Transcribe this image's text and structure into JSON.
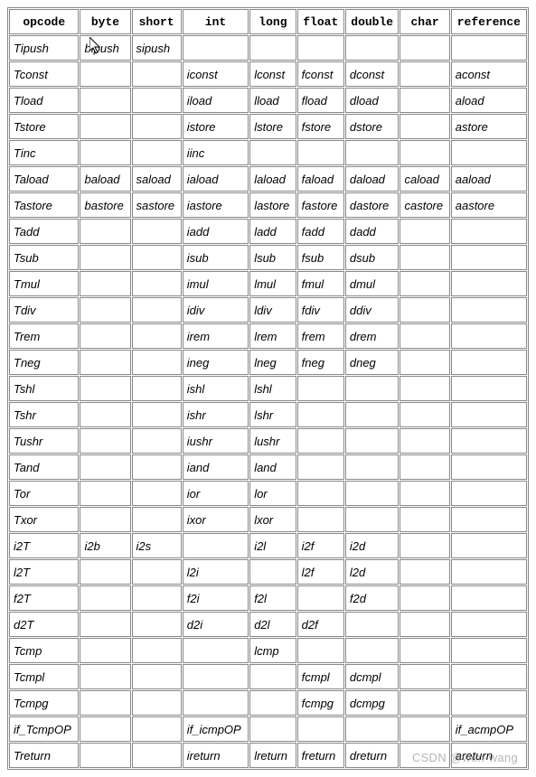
{
  "watermark": "CSDN @wen-wang",
  "table": {
    "headers": [
      "opcode",
      "byte",
      "short",
      "int",
      "long",
      "float",
      "double",
      "char",
      "reference"
    ],
    "rows": [
      {
        "opcode": "Tipush",
        "byte": "bipush",
        "short": "sipush",
        "int": "",
        "long": "",
        "float": "",
        "double": "",
        "char": "",
        "reference": ""
      },
      {
        "opcode": "Tconst",
        "byte": "",
        "short": "",
        "int": "iconst",
        "long": "lconst",
        "float": "fconst",
        "double": "dconst",
        "char": "",
        "reference": "aconst"
      },
      {
        "opcode": "Tload",
        "byte": "",
        "short": "",
        "int": "iload",
        "long": "lload",
        "float": "fload",
        "double": "dload",
        "char": "",
        "reference": "aload"
      },
      {
        "opcode": "Tstore",
        "byte": "",
        "short": "",
        "int": "istore",
        "long": "lstore",
        "float": "fstore",
        "double": "dstore",
        "char": "",
        "reference": "astore"
      },
      {
        "opcode": "Tinc",
        "byte": "",
        "short": "",
        "int": "iinc",
        "long": "",
        "float": "",
        "double": "",
        "char": "",
        "reference": ""
      },
      {
        "opcode": "Taload",
        "byte": "baload",
        "short": "saload",
        "int": "iaload",
        "long": "laload",
        "float": "faload",
        "double": "daload",
        "char": "caload",
        "reference": "aaload"
      },
      {
        "opcode": "Tastore",
        "byte": "bastore",
        "short": "sastore",
        "int": "iastore",
        "long": "lastore",
        "float": "fastore",
        "double": "dastore",
        "char": "castore",
        "reference": "aastore"
      },
      {
        "opcode": "Tadd",
        "byte": "",
        "short": "",
        "int": "iadd",
        "long": "ladd",
        "float": "fadd",
        "double": "dadd",
        "char": "",
        "reference": ""
      },
      {
        "opcode": "Tsub",
        "byte": "",
        "short": "",
        "int": "isub",
        "long": "lsub",
        "float": "fsub",
        "double": "dsub",
        "char": "",
        "reference": ""
      },
      {
        "opcode": "Tmul",
        "byte": "",
        "short": "",
        "int": "imul",
        "long": "lmul",
        "float": "fmul",
        "double": "dmul",
        "char": "",
        "reference": ""
      },
      {
        "opcode": "Tdiv",
        "byte": "",
        "short": "",
        "int": "idiv",
        "long": "ldiv",
        "float": "fdiv",
        "double": "ddiv",
        "char": "",
        "reference": ""
      },
      {
        "opcode": "Trem",
        "byte": "",
        "short": "",
        "int": "irem",
        "long": "lrem",
        "float": "frem",
        "double": "drem",
        "char": "",
        "reference": ""
      },
      {
        "opcode": "Tneg",
        "byte": "",
        "short": "",
        "int": "ineg",
        "long": "lneg",
        "float": "fneg",
        "double": "dneg",
        "char": "",
        "reference": ""
      },
      {
        "opcode": "Tshl",
        "byte": "",
        "short": "",
        "int": "ishl",
        "long": "lshl",
        "float": "",
        "double": "",
        "char": "",
        "reference": ""
      },
      {
        "opcode": "Tshr",
        "byte": "",
        "short": "",
        "int": "ishr",
        "long": "lshr",
        "float": "",
        "double": "",
        "char": "",
        "reference": ""
      },
      {
        "opcode": "Tushr",
        "byte": "",
        "short": "",
        "int": "iushr",
        "long": "lushr",
        "float": "",
        "double": "",
        "char": "",
        "reference": ""
      },
      {
        "opcode": "Tand",
        "byte": "",
        "short": "",
        "int": "iand",
        "long": "land",
        "float": "",
        "double": "",
        "char": "",
        "reference": ""
      },
      {
        "opcode": "Tor",
        "byte": "",
        "short": "",
        "int": "ior",
        "long": "lor",
        "float": "",
        "double": "",
        "char": "",
        "reference": ""
      },
      {
        "opcode": "Txor",
        "byte": "",
        "short": "",
        "int": "ixor",
        "long": "lxor",
        "float": "",
        "double": "",
        "char": "",
        "reference": ""
      },
      {
        "opcode": "i2T",
        "byte": "i2b",
        "short": "i2s",
        "int": "",
        "long": "i2l",
        "float": "i2f",
        "double": "i2d",
        "char": "",
        "reference": ""
      },
      {
        "opcode": "l2T",
        "byte": "",
        "short": "",
        "int": "l2i",
        "long": "",
        "float": "l2f",
        "double": "l2d",
        "char": "",
        "reference": ""
      },
      {
        "opcode": "f2T",
        "byte": "",
        "short": "",
        "int": "f2i",
        "long": "f2l",
        "float": "",
        "double": "f2d",
        "char": "",
        "reference": ""
      },
      {
        "opcode": "d2T",
        "byte": "",
        "short": "",
        "int": "d2i",
        "long": "d2l",
        "float": "d2f",
        "double": "",
        "char": "",
        "reference": ""
      },
      {
        "opcode": "Tcmp",
        "byte": "",
        "short": "",
        "int": "",
        "long": "lcmp",
        "float": "",
        "double": "",
        "char": "",
        "reference": ""
      },
      {
        "opcode": "Tcmpl",
        "byte": "",
        "short": "",
        "int": "",
        "long": "",
        "float": "fcmpl",
        "double": "dcmpl",
        "char": "",
        "reference": ""
      },
      {
        "opcode": "Tcmpg",
        "byte": "",
        "short": "",
        "int": "",
        "long": "",
        "float": "fcmpg",
        "double": "dcmpg",
        "char": "",
        "reference": ""
      },
      {
        "opcode": "if_TcmpOP",
        "byte": "",
        "short": "",
        "int": "if_icmpOP",
        "long": "",
        "float": "",
        "double": "",
        "char": "",
        "reference": "if_acmpOP"
      },
      {
        "opcode": "Treturn",
        "byte": "",
        "short": "",
        "int": "ireturn",
        "long": "lreturn",
        "float": "freturn",
        "double": "dreturn",
        "char": "",
        "reference": "areturn"
      }
    ]
  }
}
